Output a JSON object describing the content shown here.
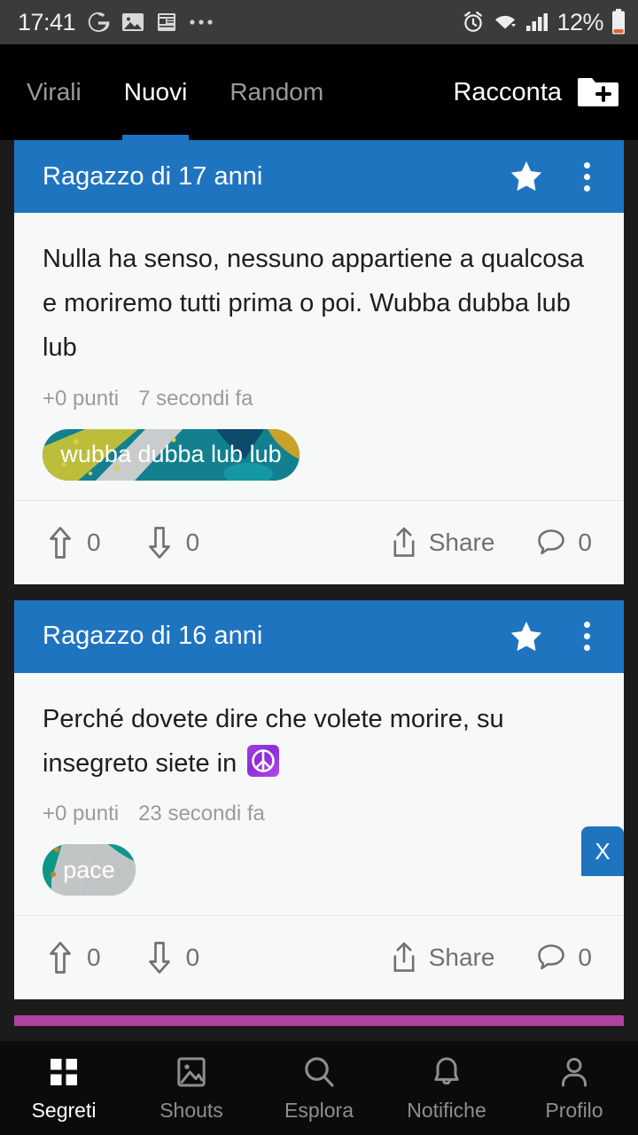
{
  "status_bar": {
    "time": "17:41",
    "battery_percent": "12%",
    "left_icons": [
      "google-g-icon",
      "gallery-icon",
      "news-widget-icon",
      "more-dots-icon"
    ],
    "right_icons": [
      "alarm-icon",
      "wifi-icon",
      "signal-icon",
      "battery-icon"
    ],
    "bg_color": "#3b3b3b"
  },
  "topbar": {
    "tabs": [
      {
        "label": "Virali",
        "active": false
      },
      {
        "label": "Nuovi",
        "active": true
      },
      {
        "label": "Random",
        "active": false
      }
    ],
    "compose_label": "Racconta",
    "compose_icon": "new-folder-plus-icon",
    "accent_color": "#1d74c7",
    "bg_color": "#000000"
  },
  "feed": {
    "card_header_color": "#1f74c0",
    "cards": [
      {
        "author": "Ragazzo di 17 anni",
        "star_icon": "star-icon",
        "menu_icon": "kebab-menu-icon",
        "text": "Nulla ha senso, nessuno appartiene a qualcosa e moriremo tutti prima o poi. Wubba dubba lub lub",
        "points": "+0 punti",
        "time": "7 secondi fa",
        "tags": [
          {
            "label": "wubba dubba lub lub"
          }
        ],
        "upvotes": "0",
        "downvotes": "0",
        "share_label": "Share",
        "comments": "0"
      },
      {
        "author": "Ragazzo di 16 anni",
        "star_icon": "star-icon",
        "menu_icon": "kebab-menu-icon",
        "text_before_emoji": "Perché dovete dire che volete morire, su insegreto siete in ",
        "emoji": "peace-sign-emoji",
        "points": "+0 punti",
        "time": "23 secondi fa",
        "tags": [
          {
            "label": "pace"
          }
        ],
        "upvotes": "0",
        "downvotes": "0",
        "share_label": "Share",
        "comments": "0"
      }
    ],
    "peek_card_color": "#b0439f"
  },
  "close_button": {
    "label": "X",
    "color": "#1f74c0"
  },
  "bottom_nav": {
    "items": [
      {
        "label": "Segreti",
        "icon": "grid-icon",
        "active": true
      },
      {
        "label": "Shouts",
        "icon": "image-icon",
        "active": false
      },
      {
        "label": "Esplora",
        "icon": "search-icon",
        "active": false
      },
      {
        "label": "Notifiche",
        "icon": "bell-icon",
        "active": false
      },
      {
        "label": "Profilo",
        "icon": "person-icon",
        "active": false
      }
    ],
    "bg_color": "#0b0b0b"
  }
}
